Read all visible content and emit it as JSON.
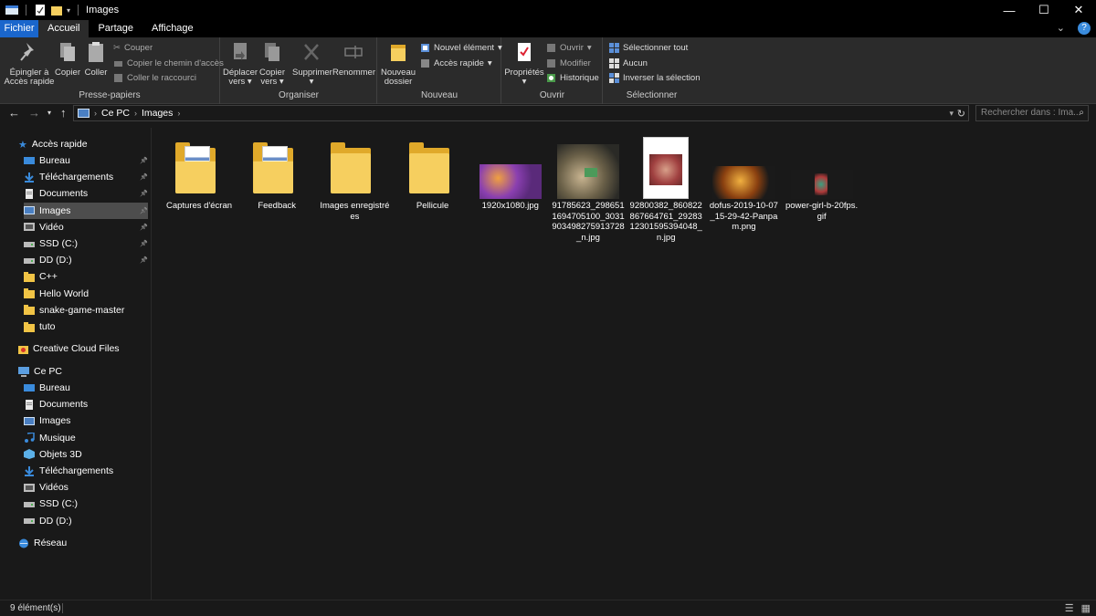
{
  "window": {
    "title": "Images",
    "controls": [
      "—",
      "☐",
      "✕"
    ]
  },
  "tabs": {
    "file": "Fichier",
    "items": [
      "Accueil",
      "Partage",
      "Affichage"
    ]
  },
  "ribbon": {
    "clipboard": {
      "label": "Presse-papiers",
      "pin_line1": "Épingler à",
      "pin_line2": "Accès rapide",
      "copy": "Copier",
      "paste": "Coller",
      "cut": "Couper",
      "copy_path": "Copier le chemin d'accès",
      "paste_shortcut": "Coller le raccourci"
    },
    "organize": {
      "label": "Organiser",
      "move_line1": "Déplacer",
      "move_line2": "vers",
      "copyto_line1": "Copier",
      "copyto_line2": "vers",
      "delete": "Supprimer",
      "rename": "Renommer"
    },
    "new": {
      "label": "Nouveau",
      "folder_line1": "Nouveau",
      "folder_line2": "dossier",
      "new_item": "Nouvel élément",
      "easy_access": "Accès rapide"
    },
    "open": {
      "label": "Ouvrir",
      "properties": "Propriétés",
      "open": "Ouvrir",
      "edit": "Modifier",
      "history": "Historique"
    },
    "select": {
      "label": "Sélectionner",
      "select_all": "Sélectionner tout",
      "select_none": "Aucun",
      "invert": "Inverser la sélection"
    }
  },
  "address": {
    "crumbs": [
      "Ce PC",
      "Images"
    ],
    "search_placeholder": "Rechercher dans : Ima..."
  },
  "sidebar": {
    "quick_access": "Accès rapide",
    "quick_items": [
      {
        "label": "Bureau",
        "icon": "desktop-icon",
        "pinned": true
      },
      {
        "label": "Téléchargements",
        "icon": "download-icon",
        "pinned": true
      },
      {
        "label": "Documents",
        "icon": "documents-icon",
        "pinned": true
      },
      {
        "label": "Images",
        "icon": "images-icon",
        "pinned": true,
        "selected": true
      },
      {
        "label": "Vidéo",
        "icon": "video-icon",
        "pinned": true
      },
      {
        "label": "SSD (C:)",
        "icon": "drive-icon",
        "pinned": true
      },
      {
        "label": "DD (D:)",
        "icon": "drive-icon",
        "pinned": true
      },
      {
        "label": "C++",
        "icon": "folder-icon"
      },
      {
        "label": "Hello World",
        "icon": "folder-icon"
      },
      {
        "label": "snake-game-master",
        "icon": "folder-icon"
      },
      {
        "label": "tuto",
        "icon": "folder-icon"
      }
    ],
    "creative_cloud": "Creative Cloud Files",
    "this_pc": "Ce PC",
    "pc_items": [
      {
        "label": "Bureau",
        "icon": "desktop-icon"
      },
      {
        "label": "Documents",
        "icon": "documents-icon"
      },
      {
        "label": "Images",
        "icon": "images-icon"
      },
      {
        "label": "Musique",
        "icon": "music-icon"
      },
      {
        "label": "Objets 3D",
        "icon": "objects3d-icon"
      },
      {
        "label": "Téléchargements",
        "icon": "download-icon"
      },
      {
        "label": "Vidéos",
        "icon": "video-icon"
      },
      {
        "label": "SSD (C:)",
        "icon": "drive-icon"
      },
      {
        "label": "DD (D:)",
        "icon": "drive-icon"
      }
    ],
    "network": "Réseau"
  },
  "files": [
    {
      "name": "Captures d'écran",
      "type": "folder-with-content"
    },
    {
      "name": "Feedback",
      "type": "folder-with-content"
    },
    {
      "name": "Images enregistrées",
      "type": "folder"
    },
    {
      "name": "Pellicule",
      "type": "folder"
    },
    {
      "name": "1920x1080.jpg",
      "type": "image-wide"
    },
    {
      "name": "91785623_2986511694705100_3031903498275913728_n.jpg",
      "type": "image-photo"
    },
    {
      "name": "92800382_860822867664761_2928312301595394048_n.jpg",
      "type": "image-portrait"
    },
    {
      "name": "dofus-2019-10-07_15-29-42-Panpam.png",
      "type": "image-game"
    },
    {
      "name": "power-girl-b-20fps.gif",
      "type": "image-gif"
    }
  ],
  "status": {
    "count": "9 élément(s)"
  },
  "colors": {
    "accent": "#1a66cc",
    "folder": "#f6cf5f",
    "background": "#191919",
    "ribbon": "#2b2b2b"
  }
}
